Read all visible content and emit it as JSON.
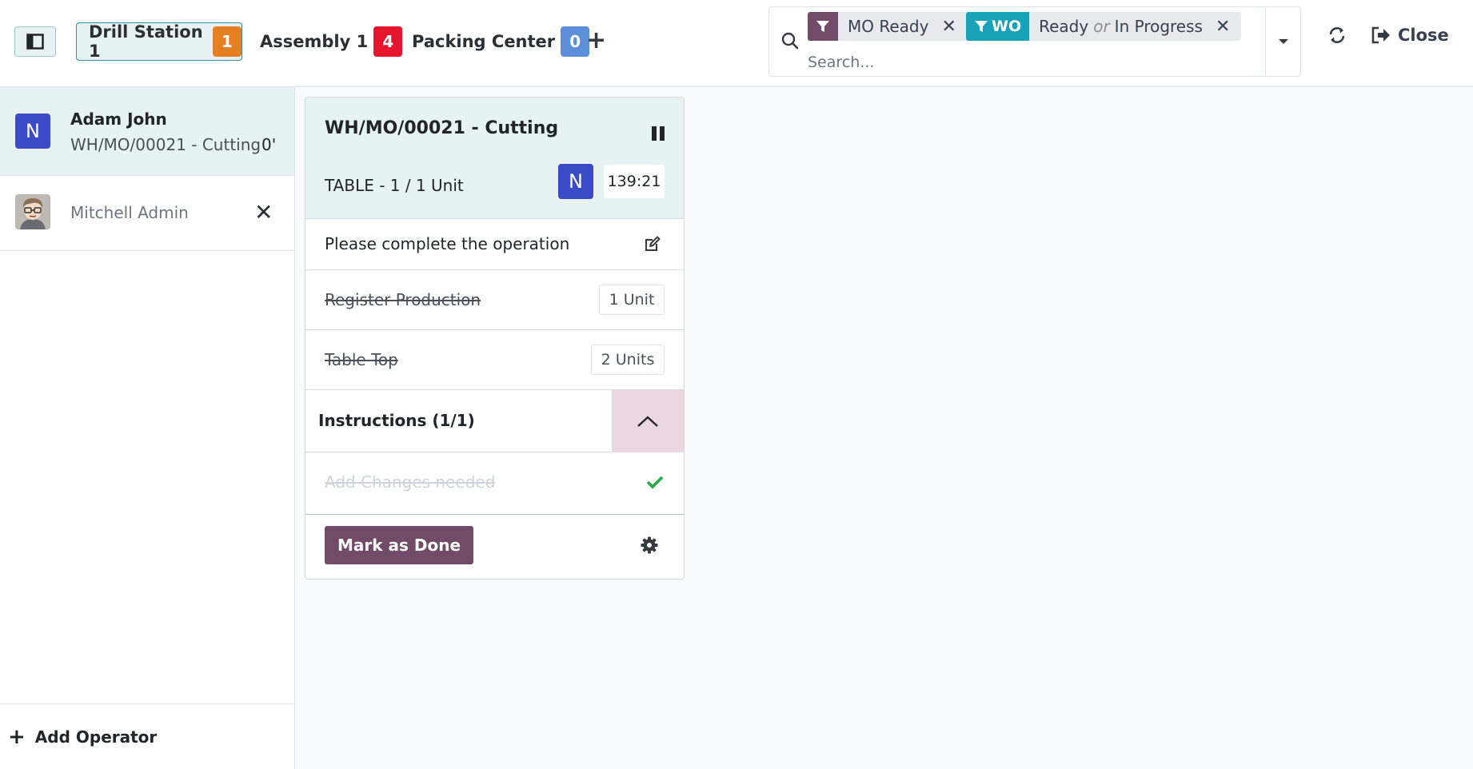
{
  "header": {
    "workcenters": [
      {
        "name": "Drill Station 1",
        "count": "1",
        "color": "#e67e22"
      },
      {
        "name": "Assembly 1",
        "count": "4",
        "color": "#e8152e"
      },
      {
        "name": "Packing Center",
        "count": "0",
        "color": "#5b8fd9"
      }
    ],
    "add_workcenter_icon": "plus-icon",
    "search": {
      "facets": [
        {
          "type": "filter",
          "label": "MO Ready",
          "color": "#714b67"
        },
        {
          "type": "filter",
          "prefix": "WO",
          "values": [
            "Ready",
            "In Progress"
          ],
          "separator": "or",
          "color": "#17a2b8"
        }
      ],
      "placeholder": "Search..."
    },
    "close_label": "Close"
  },
  "operators": {
    "active": {
      "initial": "N",
      "name": "Adam John",
      "workorder": "WH/MO/00021 - Cutting",
      "time": "0'"
    },
    "idle": {
      "name": "Mitchell Admin"
    },
    "add_label": "Add Operator"
  },
  "card": {
    "title": "WH/MO/00021 - Cutting",
    "product_line": "TABLE - 1 / 1 Unit",
    "operator_initial": "N",
    "timer": "139:21",
    "note": "Please complete the operation",
    "steps": [
      {
        "label": "Register Production",
        "qty": "1 Unit"
      },
      {
        "label": "Table Top",
        "qty": "2 Units"
      }
    ],
    "instructions_label": "Instructions (1/1)",
    "instruction_step": "Add Changes needed",
    "mark_done_label": "Mark as Done"
  }
}
